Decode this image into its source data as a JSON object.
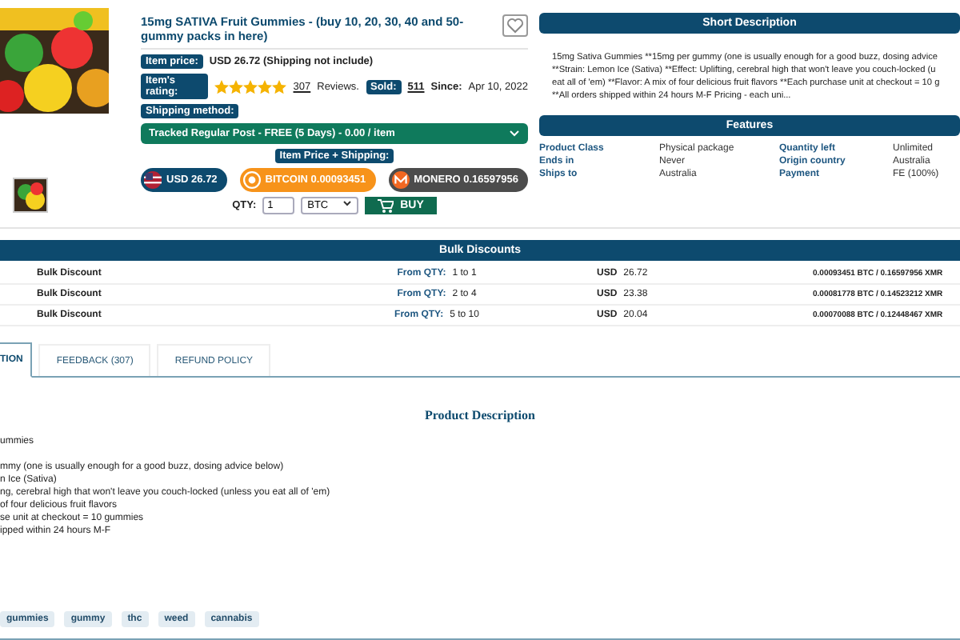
{
  "product": {
    "title": "15mg SATIVA Fruit Gummies - (buy 10, 20, 30, 40 and 50-gummy packs in here)",
    "price_label": "Item price:",
    "price": "USD 26.72 (Shipping not include)",
    "rating_label": "Item's rating:",
    "stars": 5,
    "reviews_count": "307",
    "reviews_word": "Reviews.",
    "sold_label": "Sold:",
    "sold": "511",
    "since_label": "Since:",
    "since": "Apr 10, 2022",
    "shipping_label": "Shipping method:",
    "shipping": "Tracked Regular Post - FREE (5 Days) - 0.00 / item",
    "total_label": "Item Price + Shipping:",
    "prices": [
      {
        "kind": "usd",
        "label": "USD 26.72"
      },
      {
        "kind": "btc",
        "label": "BITCOIN 0.00093451"
      },
      {
        "kind": "xmr",
        "label": "MONERO 0.16597956"
      }
    ],
    "qty_label": "QTY:",
    "qty": "1",
    "currency": "BTC",
    "buy": "BUY"
  },
  "short_description": {
    "title": "Short Description",
    "lines": [
      "15mg Sativa Gummies **15mg per gummy (one is usually enough for a good buzz, dosing advice",
      "**Strain: Lemon Ice (Sativa) **Effect: Uplifting, cerebral high that won't leave you couch-locked (u",
      "eat all of 'em) **Flavor: A mix of four delicious fruit flavors **Each purchase unit at checkout = 10 g",
      "**All orders shipped within 24 hours M-F Pricing - each uni..."
    ]
  },
  "features": {
    "title": "Features",
    "rows": [
      [
        "Product Class",
        "Physical package",
        "Quantity left",
        "Unlimited"
      ],
      [
        "Ends in",
        "Never",
        "Origin country",
        "Australia"
      ],
      [
        "Ships to",
        "Australia",
        "Payment",
        "FE (100%)"
      ]
    ]
  },
  "bulk": {
    "title": "Bulk Discounts",
    "rows": [
      {
        "name": "Bulk Discount",
        "qty_label": "From QTY:",
        "qty": "1 to 1",
        "cur": "USD",
        "price": "26.72",
        "crypto": "0.00093451 BTC / 0.16597956 XMR"
      },
      {
        "name": "Bulk Discount",
        "qty_label": "From QTY:",
        "qty": "2 to 4",
        "cur": "USD",
        "price": "23.38",
        "crypto": "0.00081778 BTC / 0.14523212 XMR"
      },
      {
        "name": "Bulk Discount",
        "qty_label": "From QTY:",
        "qty": "5 to 10",
        "cur": "USD",
        "price": "20.04",
        "crypto": "0.00070088 BTC / 0.12448467 XMR"
      }
    ]
  },
  "tabs": [
    {
      "label": "TION",
      "selected": true
    },
    {
      "label": "FEEDBACK (307)",
      "selected": false
    },
    {
      "label": "REFUND POLICY",
      "selected": false
    }
  ],
  "description": {
    "title": "Product Description",
    "intro": "ummies",
    "lines": [
      "mmy (one is usually enough for a good buzz, dosing advice below)",
      "n Ice (Sativa)",
      "ng, cerebral high that won't leave you couch-locked (unless you eat all of 'em)",
      "of four delicious fruit flavors",
      "se unit at checkout = 10 gummies",
      "ipped within 24 hours M-F"
    ]
  },
  "tags": [
    "gummies",
    "gummy",
    "thc",
    "weed",
    "cannabis"
  ]
}
